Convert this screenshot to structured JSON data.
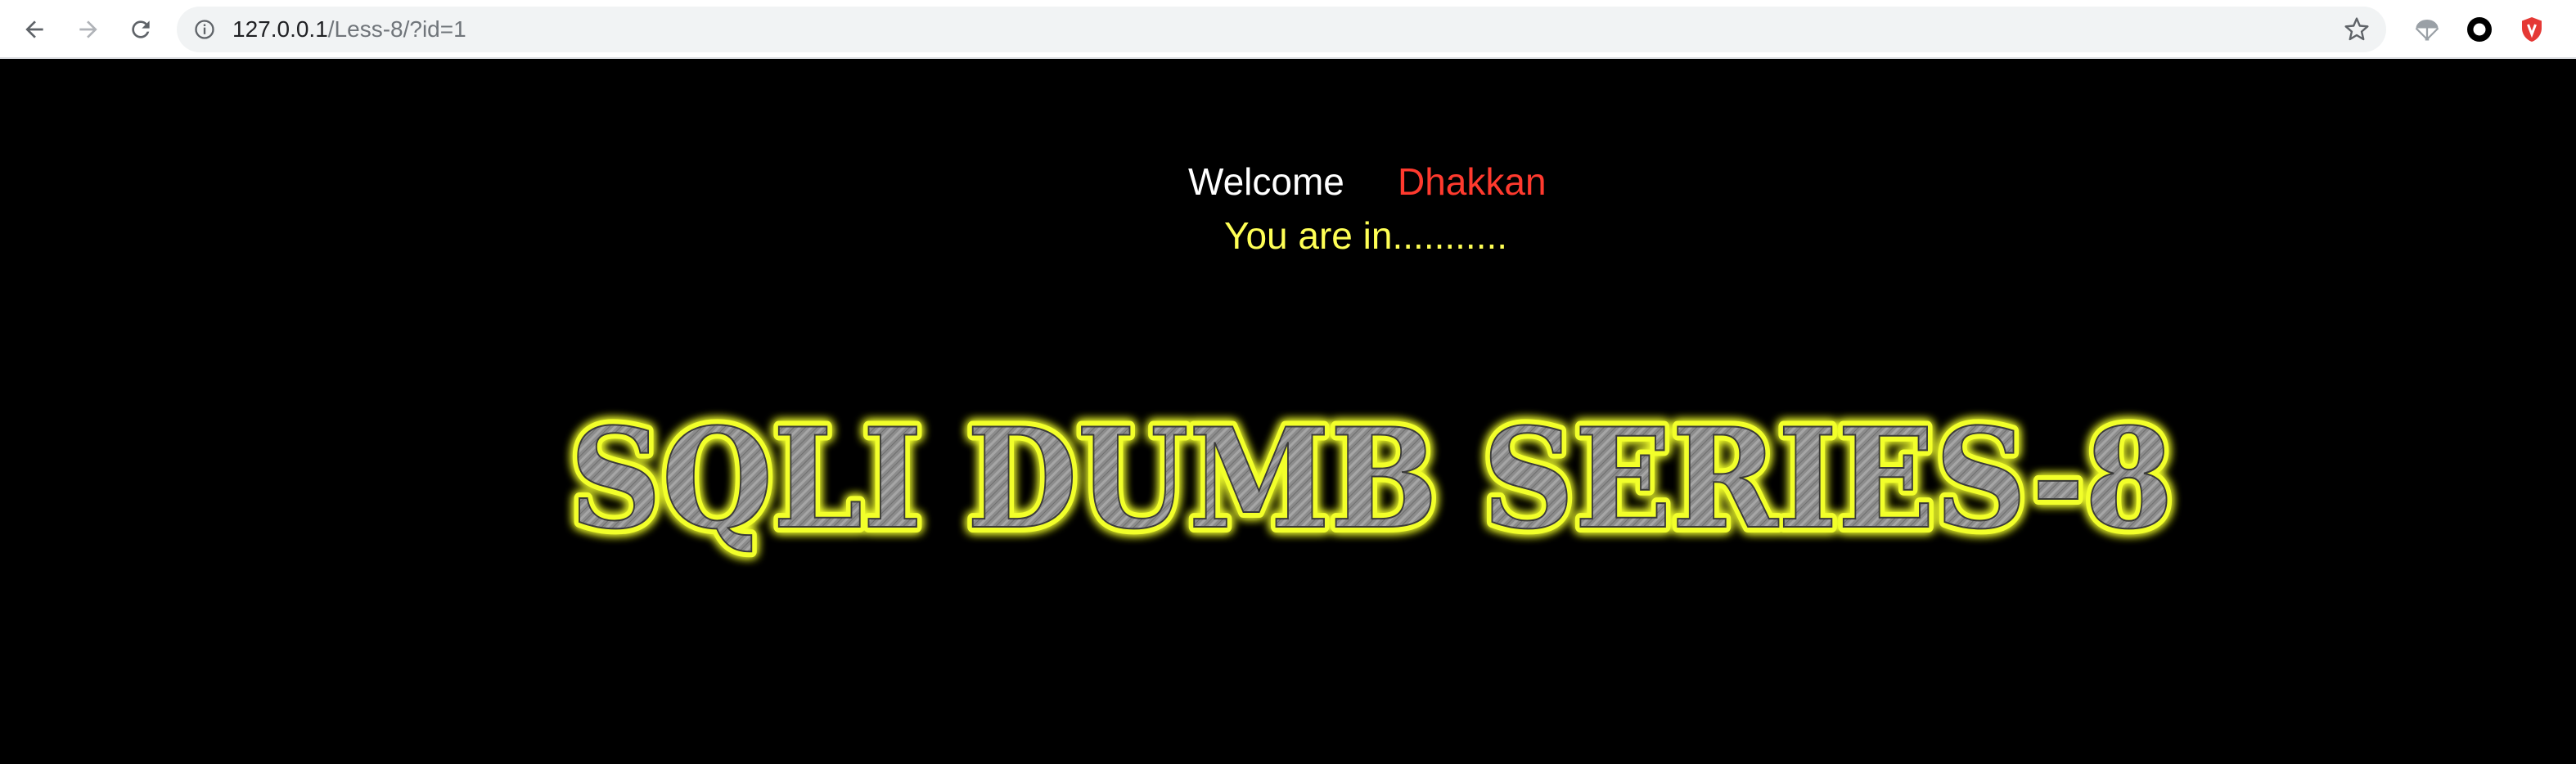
{
  "browser": {
    "url_host": "127.0.0.1",
    "url_path": "/Less-8/?id=1"
  },
  "page": {
    "welcome_label": "Welcome",
    "username": "Dhakkan",
    "status_message": "You are in...........",
    "banner_title": "SQLI DUMB SERIES-8"
  },
  "colors": {
    "background": "#000000",
    "welcome": "#ffffff",
    "username": "#ff3a2e",
    "status": "#ffff55",
    "banner_glow": "#f2ff2a",
    "banner_fill": "#8a8a8a"
  },
  "icons": {
    "back": "arrow-left-icon",
    "forward": "arrow-right-icon",
    "reload": "reload-icon",
    "site_info": "info-icon",
    "bookmark": "star-icon",
    "extensions": [
      "parachute-icon",
      "ring-icon",
      "shield-icon"
    ]
  }
}
